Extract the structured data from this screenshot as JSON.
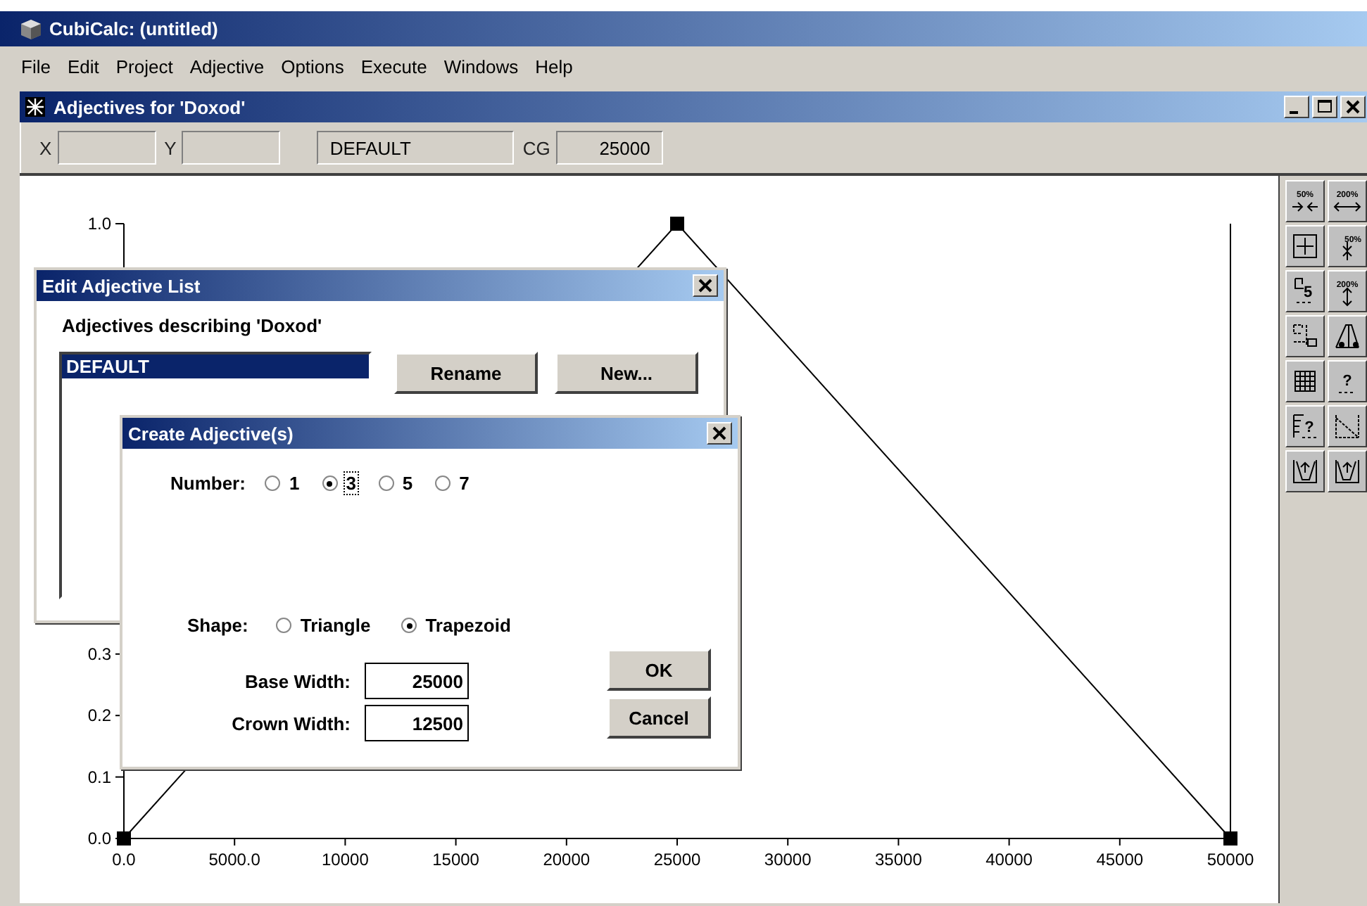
{
  "app_window": {
    "title": "CubiCalc: (untitled)"
  },
  "menu": [
    "File",
    "Edit",
    "Project",
    "Adjective",
    "Options",
    "Execute",
    "Windows",
    "Help"
  ],
  "child_window": {
    "title": "Adjectives for 'Doxod'",
    "fields": [
      {
        "label": "X"
      },
      {
        "label": "Y"
      },
      {
        "value": "DEFAULT"
      },
      {
        "label": "CG",
        "value": "25000"
      }
    ],
    "chart_data": {
      "type": "line",
      "x": [
        0,
        25000,
        50000
      ],
      "series": [
        {
          "color": "#000000",
          "marker": "square",
          "values": [
            0,
            1,
            0
          ]
        }
      ],
      "xlim": [
        0,
        50000
      ],
      "ylim": [
        0,
        1
      ],
      "xticks": [
        {
          "value": 0,
          "label": "0.0"
        },
        {
          "value": 5000,
          "label": "5000.0"
        },
        10000,
        15000,
        20000,
        25000,
        30000,
        35000,
        40000,
        45000,
        50000
      ],
      "yticks": [
        {
          "value": 0,
          "label": "0.0"
        },
        {
          "value": 0.1,
          "label": "0.1"
        },
        {
          "value": 0.2,
          "label": "0.2"
        },
        {
          "value": 0.3,
          "label": "0.3"
        },
        {
          "value": 1,
          "label": "1.0"
        }
      ]
    },
    "tools": [
      {
        "kind": "shrink-h",
        "label": "50%"
      },
      {
        "kind": "grow-h",
        "label": "200%"
      },
      {
        "kind": "fit"
      },
      {
        "kind": "shrink-v",
        "label": "50%"
      },
      {
        "kind": "point",
        "label": "5"
      },
      {
        "kind": "grow-v",
        "label": "200%"
      },
      {
        "kind": "move"
      },
      {
        "kind": "shape"
      },
      {
        "kind": "grid"
      },
      {
        "kind": "help",
        "label": "?"
      },
      {
        "kind": "table-help",
        "label": "?"
      },
      {
        "kind": "diagonal"
      },
      {
        "kind": "trap-left"
      },
      {
        "kind": "trap-right"
      }
    ]
  },
  "edit_dialog": {
    "title": "Edit Adjective List",
    "caption": "Adjectives describing 'Doxod'",
    "list": [
      {
        "label": "DEFAULT",
        "selected": true
      }
    ],
    "buttons": [
      "Rename",
      "New..."
    ]
  },
  "create_dialog": {
    "title": "Create Adjective(s)",
    "number_label": "Number:",
    "number_options": [
      {
        "label": "1",
        "selected": false
      },
      {
        "label": "3",
        "selected": true
      },
      {
        "label": "5",
        "selected": false
      },
      {
        "label": "7",
        "selected": false
      }
    ],
    "shape_label": "Shape:",
    "shape_options": [
      {
        "label": "Triangle",
        "selected": false
      },
      {
        "label": "Trapezoid",
        "selected": true
      }
    ],
    "inputs": [
      {
        "label": "Base Width:",
        "value": "25000"
      },
      {
        "label": "Crown Width:",
        "value": "12500"
      }
    ],
    "buttons": [
      "OK",
      "Cancel"
    ]
  }
}
